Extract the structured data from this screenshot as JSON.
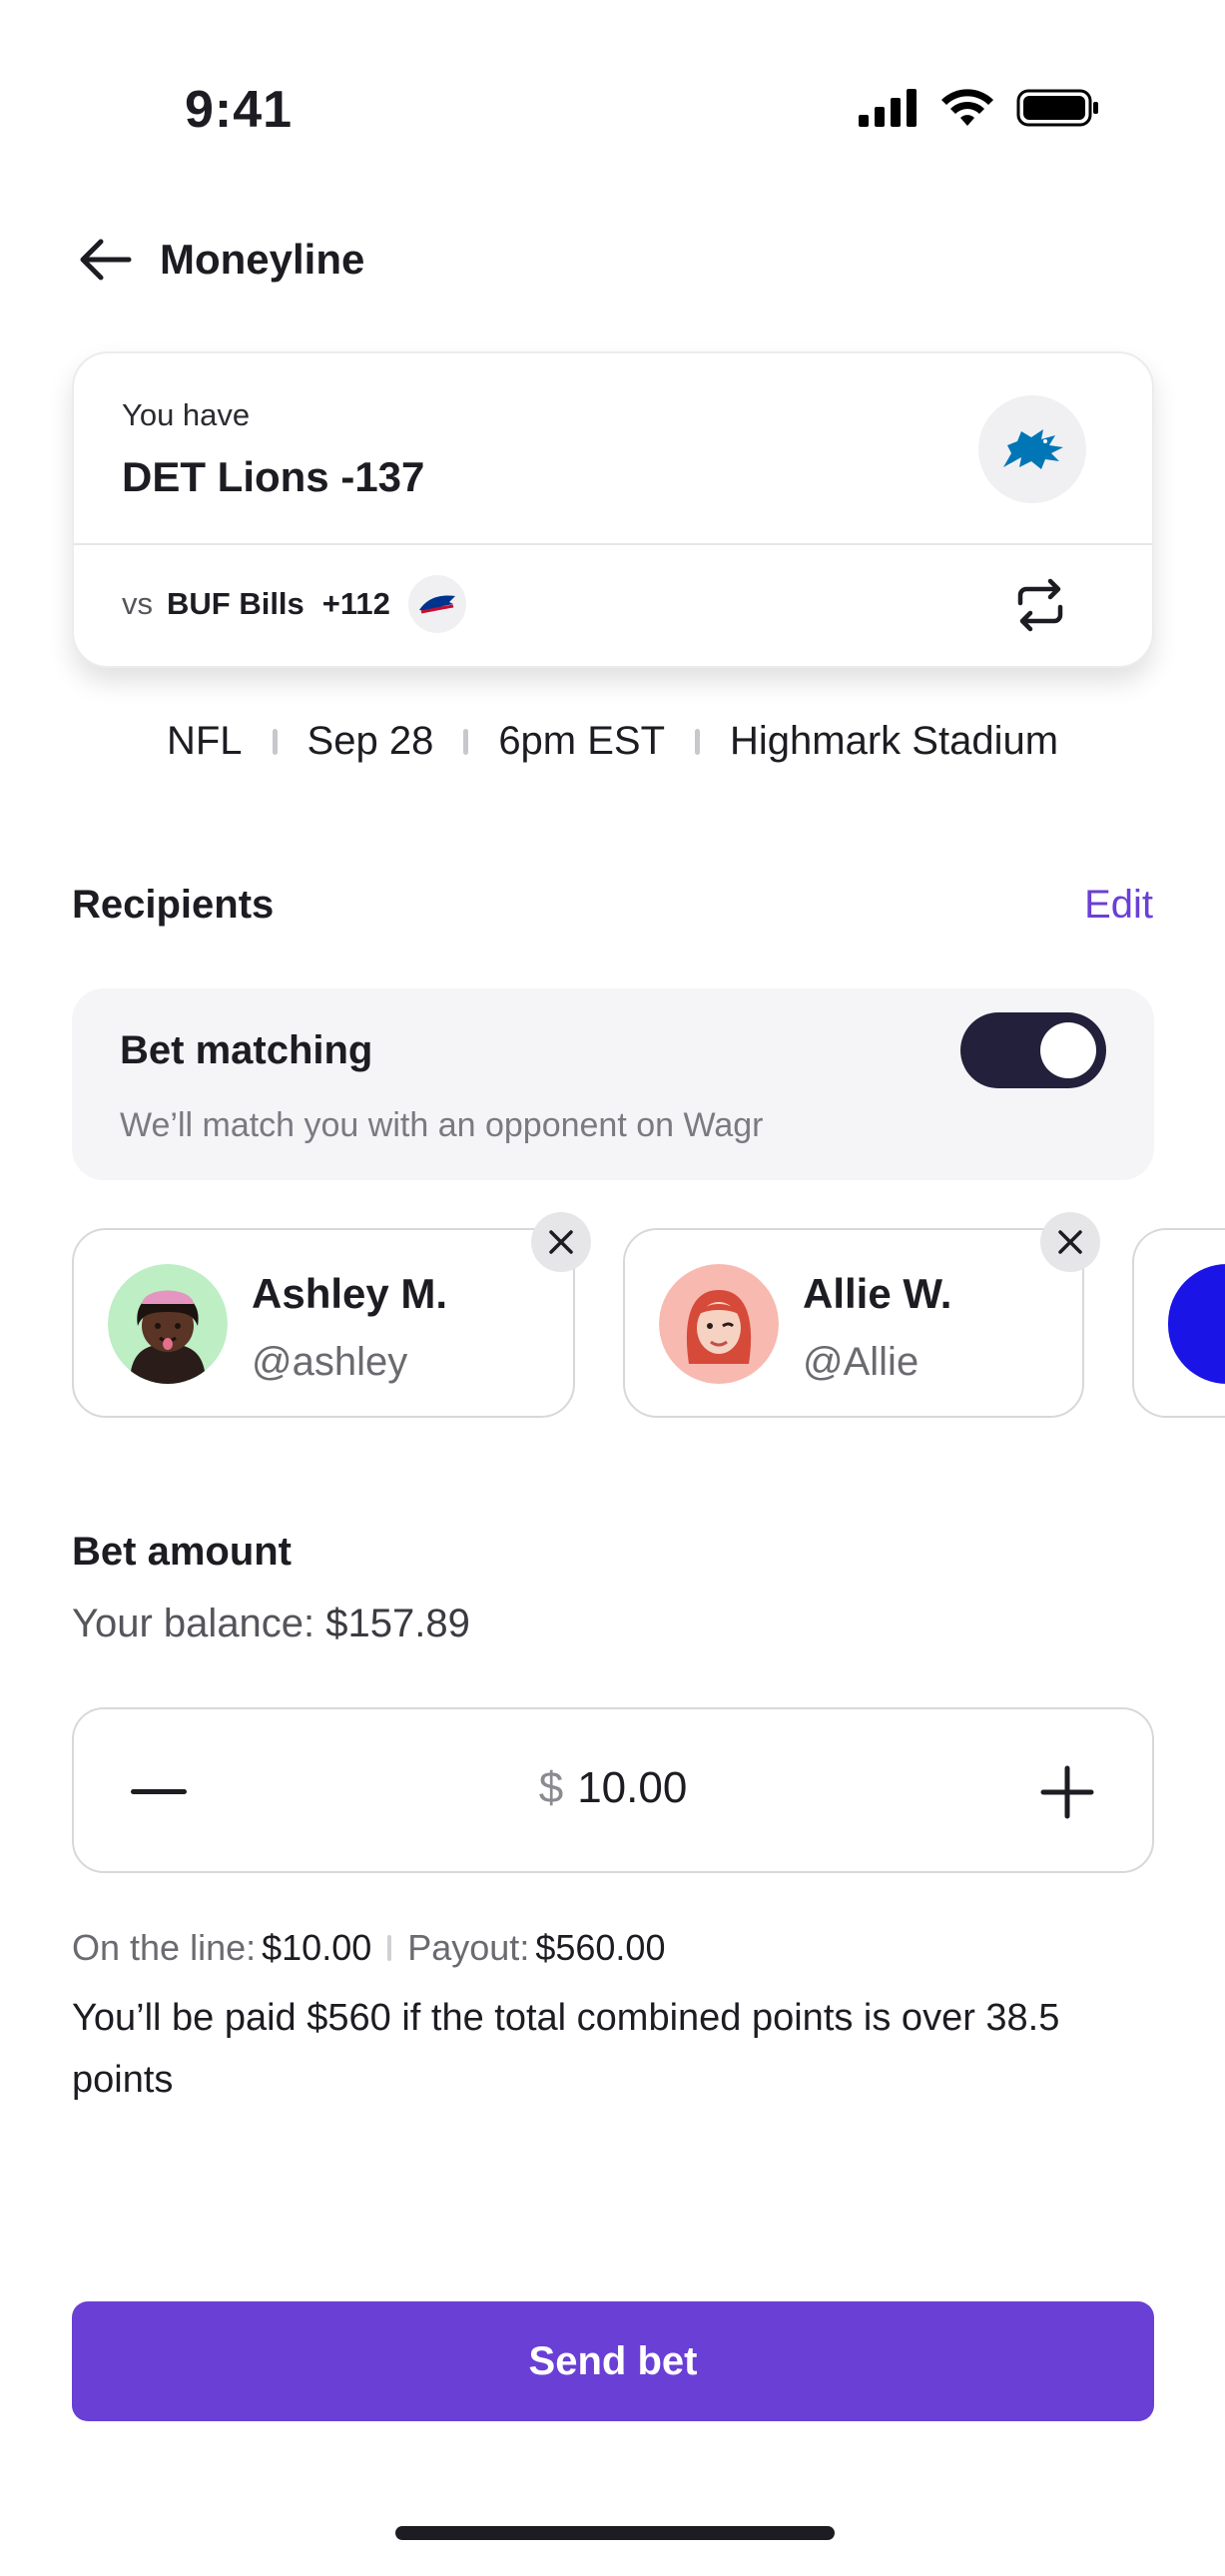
{
  "status_bar": {
    "time": "9:41"
  },
  "header": {
    "title": "Moneyline"
  },
  "bet_card": {
    "you_have_label": "You have",
    "pick": "DET Lions -137",
    "vs_label": "vs",
    "opponent_team": "BUF Bills",
    "opponent_odds": "+112"
  },
  "game_info": {
    "league": "NFL",
    "date": "Sep 28",
    "time": "6pm EST",
    "venue": "Highmark Stadium"
  },
  "recipients": {
    "title": "Recipients",
    "edit_label": "Edit",
    "matching": {
      "title": "Bet matching",
      "description": "We’ll match you with an opponent on Wagr",
      "enabled": true
    },
    "people": [
      {
        "name": "Ashley M.",
        "handle": "@ashley"
      },
      {
        "name": "Allie W.",
        "handle": "@Allie"
      }
    ]
  },
  "bet_amount": {
    "title": "Bet amount",
    "balance_label": "Your balance:",
    "balance_value": "$157.89",
    "currency_symbol": "$",
    "amount": "10.00",
    "on_the_line_label": "On the line:",
    "on_the_line_value": "$10.00",
    "payout_label": "Payout:",
    "payout_value": "$560.00",
    "description": "You’ll be paid $560 if the total combined points is over 38.5 points"
  },
  "send_button": {
    "label": "Send bet"
  },
  "colors": {
    "accent": "#6a3fd6",
    "toggle_on": "#22203a",
    "lions_blue": "#0076b6",
    "bills_blue": "#00338d",
    "bills_red": "#c60c30"
  }
}
